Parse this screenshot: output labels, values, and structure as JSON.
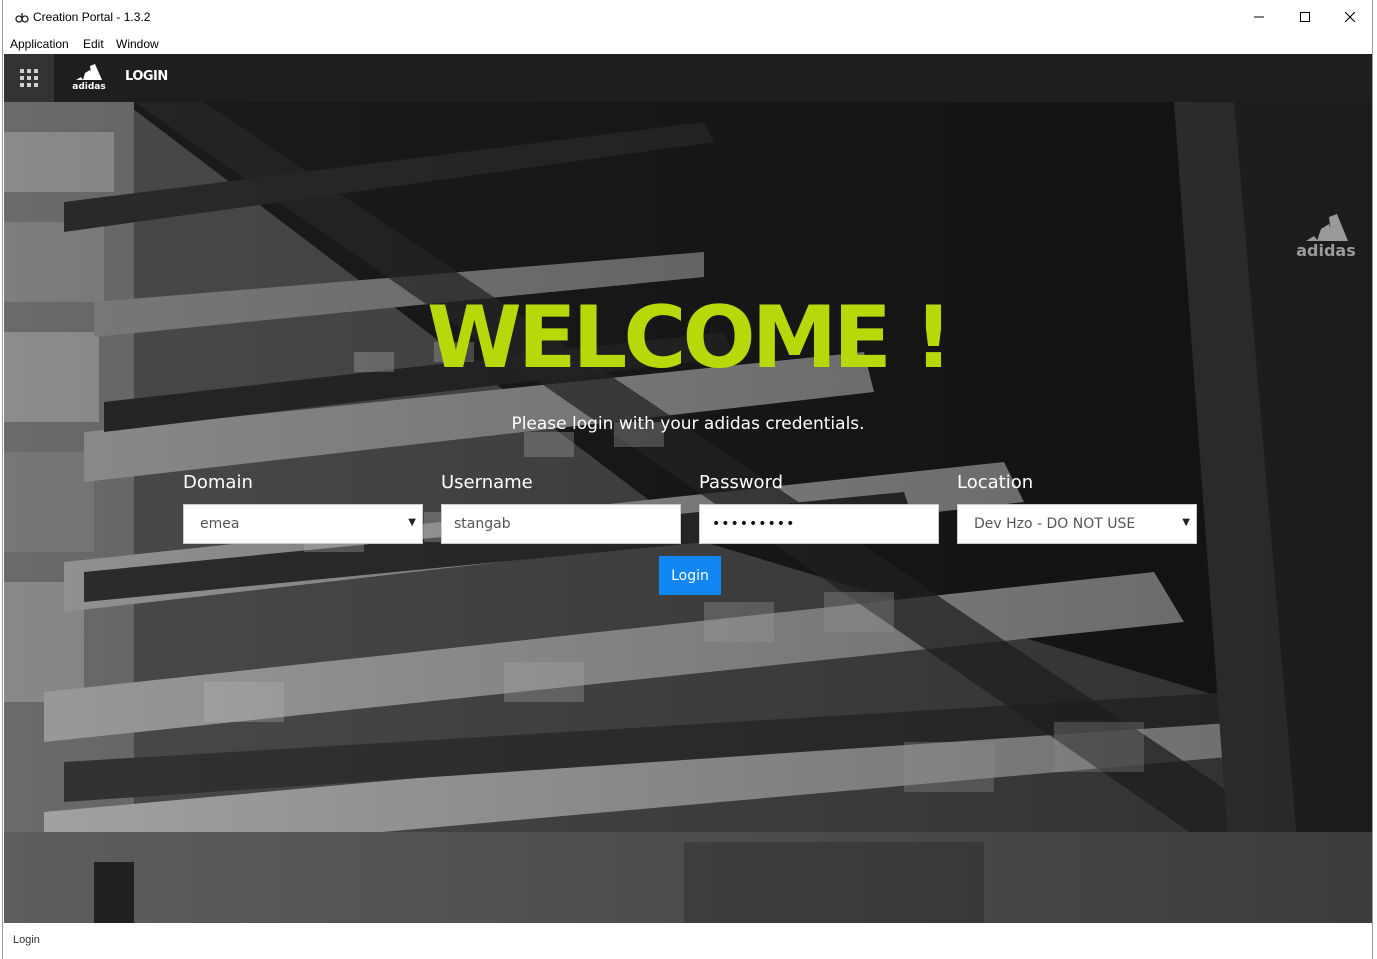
{
  "window": {
    "title": "Creation Portal - 1.3.2",
    "icons": [
      "app-icon",
      "minimize-icon",
      "maximize-icon",
      "close-icon"
    ]
  },
  "menu": {
    "items": [
      "Application",
      "Edit",
      "Window"
    ]
  },
  "header": {
    "brand": "adidas",
    "title": "LOGIN",
    "icons": [
      "apps-grid-icon",
      "adidas-logo"
    ]
  },
  "hero": {
    "heading": "WELCOME !",
    "subtitle": "Please login with your adidas credentials.",
    "corner_brand": "adidas",
    "accent_color": "#b8d80a"
  },
  "form": {
    "domain": {
      "label": "Domain",
      "value": "emea"
    },
    "username": {
      "label": "Username",
      "value": "stangab"
    },
    "password": {
      "label": "Password",
      "value": "•••••••••"
    },
    "location": {
      "label": "Location",
      "value": "Dev Hzo - DO NOT USE"
    },
    "submit_label": "Login",
    "button_color": "#1187f5"
  },
  "status": {
    "text": "Login"
  }
}
